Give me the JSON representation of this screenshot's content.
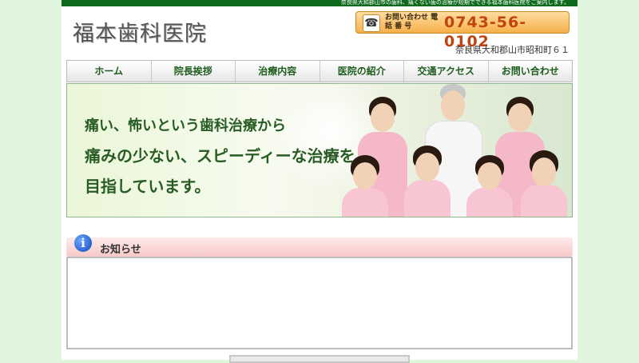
{
  "header": {
    "tagline": "奈良県大和郡山市の歯科、痛くない歯の治療が短期でできる福本歯科医院をご案内します。",
    "clinic_name": "福本歯科医院",
    "phone_label": "お問い合わせ 電 話 番 号",
    "phone_number": "0743-56-0102",
    "address": "奈良県大和郡山市昭和町６１"
  },
  "nav": {
    "items": [
      "ホーム",
      "院長挨拶",
      "治療内容",
      "医院の紹介",
      "交通アクセス",
      "お問い合わせ"
    ]
  },
  "hero": {
    "line1": "痛い、怖いという歯科治療から",
    "line2": "痛みの少ない、スピーディーな治療を",
    "line3": "目指しています。"
  },
  "notice": {
    "title": "お知らせ",
    "icon": "info-icon"
  },
  "colors": {
    "brand_green": "#0e6b1d",
    "page_bg": "#dff5dc",
    "phone_number": "#c0440f"
  }
}
